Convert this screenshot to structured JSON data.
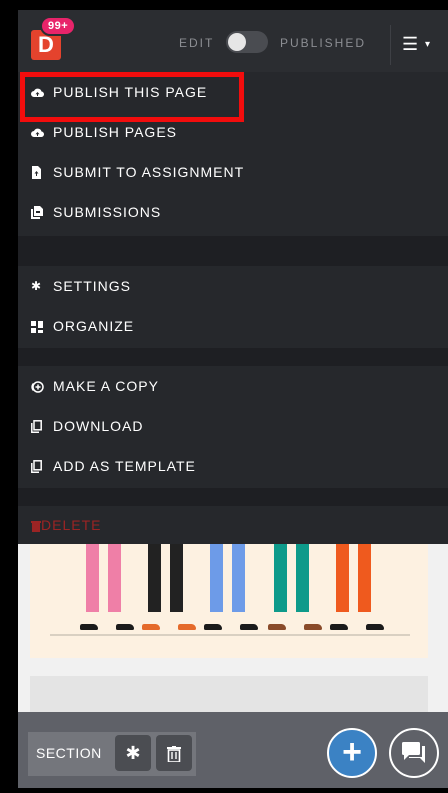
{
  "app": {
    "logo_letter": "D",
    "notifications_badge": "99+"
  },
  "header": {
    "edit_label": "EDIT",
    "published_label": "PUBLISHED",
    "mode_toggle_state": "edit"
  },
  "menu": {
    "publish_this_page": "PUBLISH THIS PAGE",
    "publish_pages": "PUBLISH PAGES",
    "submit_to_assignment": "SUBMIT TO ASSIGNMENT",
    "submissions": "SUBMISSIONS",
    "settings": "SETTINGS",
    "organize": "ORGANIZE",
    "make_a_copy": "MAKE A COPY",
    "download": "DOWNLOAD",
    "add_as_template": "ADD AS TEMPLATE",
    "delete": "DELETE"
  },
  "bottom_bar": {
    "section_label": "SECTION"
  },
  "colors": {
    "highlight_box": "#f20d0d",
    "logo_bg": "#e4432d",
    "badge_bg": "#e8246a",
    "fab_add": "#3b82c4",
    "delete_text": "#9b2424"
  }
}
